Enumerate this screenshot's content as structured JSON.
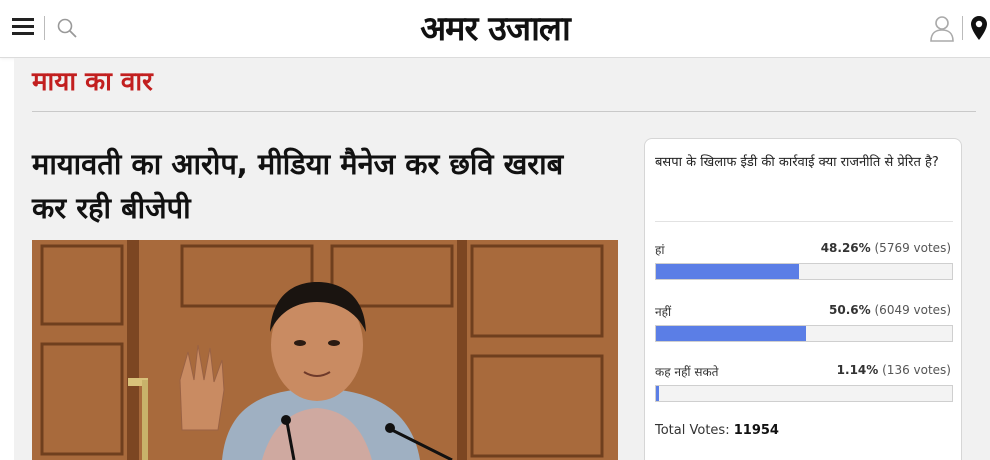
{
  "header": {
    "logo": "अमर उजाला",
    "menu_icon": "hamburger-menu-icon",
    "search_icon": "search-icon",
    "user_icon": "user-icon",
    "location_icon": "location-pin-icon"
  },
  "section": {
    "title": "माया का वार",
    "color": "#c21f1f"
  },
  "article": {
    "headline": "मायावती का आरोप, मीडिया मैनेज कर छवि खराब कर रही बीजेपी"
  },
  "poll": {
    "question": "बसपा के खिलाफ ईडी की कार्रवाई क्या राजनीति से प्रेरित है?",
    "options": [
      {
        "label": "हां",
        "percent_text": "48.26%",
        "votes_text": "(5769 votes)",
        "percent": 48.26
      },
      {
        "label": "नहीं",
        "percent_text": "50.6%",
        "votes_text": "(6049 votes)",
        "percent": 50.6
      },
      {
        "label": "कह नहीं सकते",
        "percent_text": "1.14%",
        "votes_text": "(136 votes)",
        "percent": 1.14
      }
    ],
    "total_label": "Total Votes:",
    "total_value": "11954",
    "bar_color": "#5b7ee6"
  }
}
